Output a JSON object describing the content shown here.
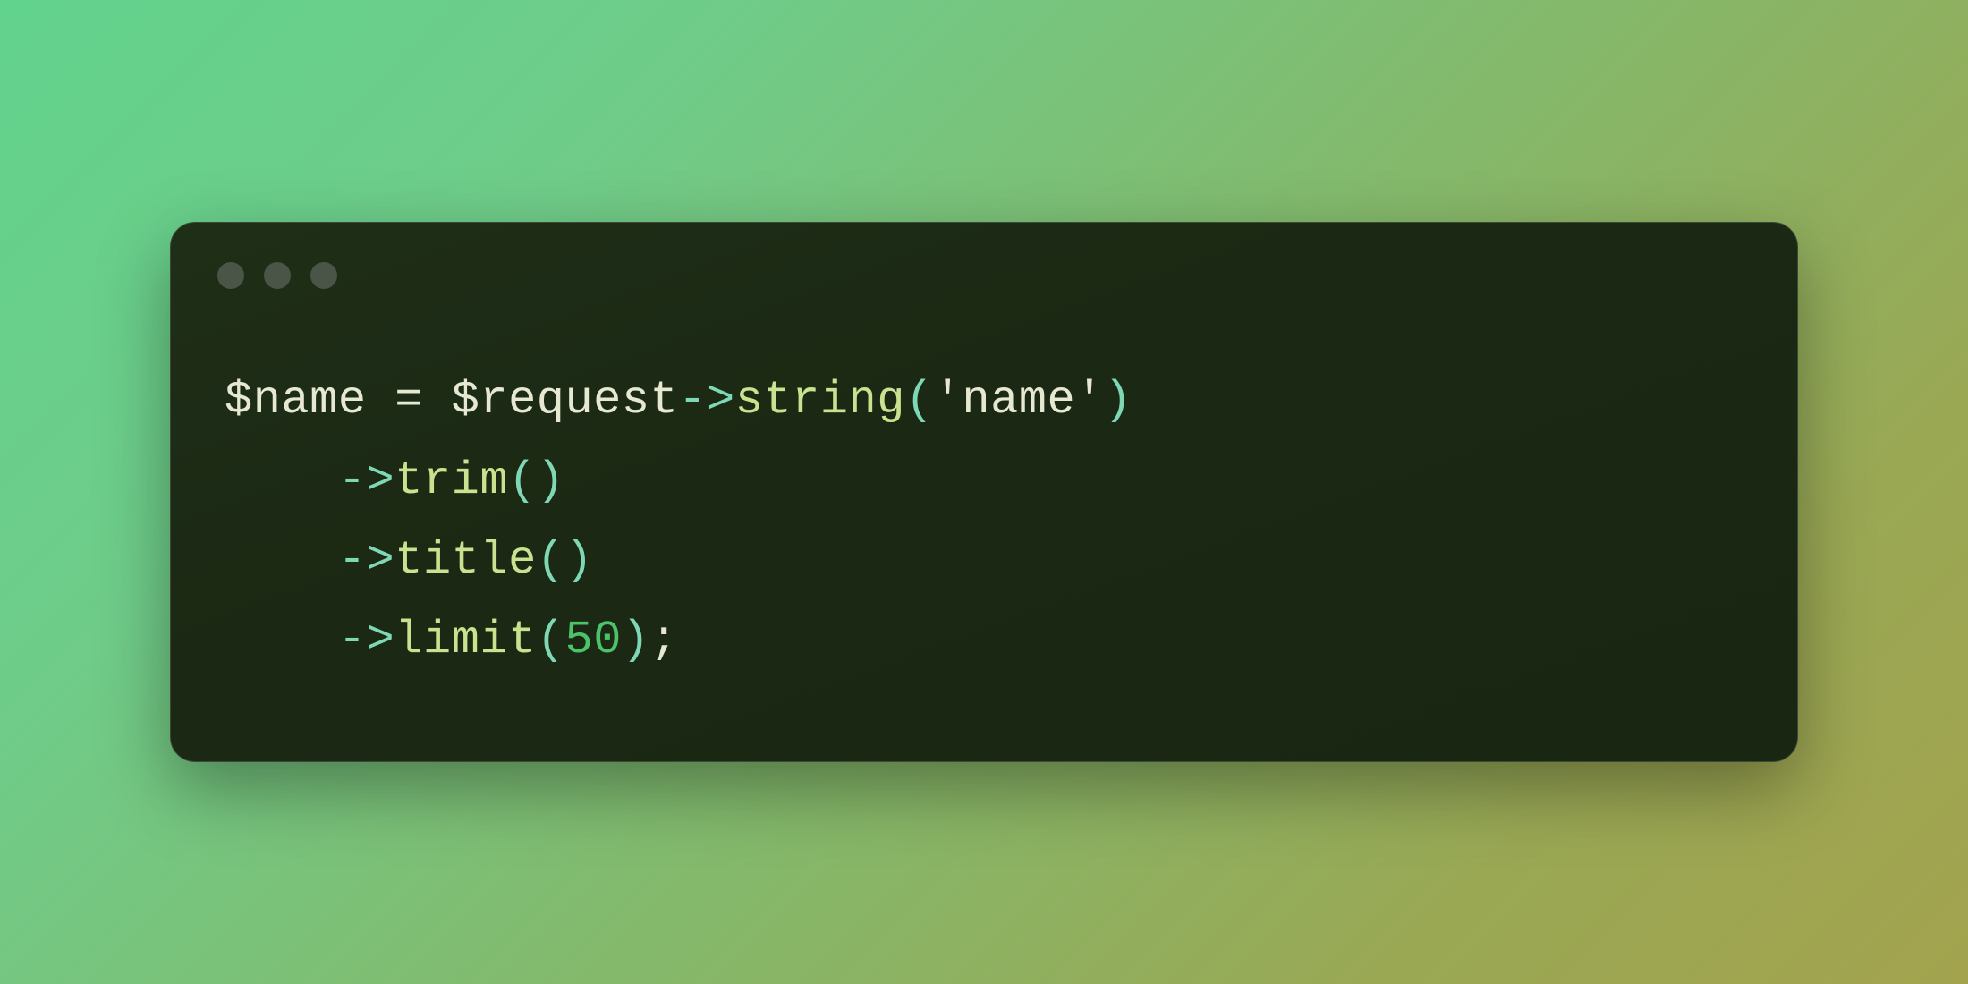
{
  "window": {
    "traffic_dots": 3
  },
  "code": {
    "indent": "    ",
    "line1": {
      "var_name": "$name",
      "assign": " = ",
      "object": "$request",
      "arrow": "->",
      "method": "string",
      "paren_open": "(",
      "arg_quote_open": "'",
      "arg_value": "name",
      "arg_quote_close": "'",
      "paren_close": ")"
    },
    "line2": {
      "arrow": "->",
      "method": "trim",
      "paren_open": "(",
      "paren_close": ")"
    },
    "line3": {
      "arrow": "->",
      "method": "title",
      "paren_open": "(",
      "paren_close": ")"
    },
    "line4": {
      "arrow": "->",
      "method": "limit",
      "paren_open": "(",
      "arg_number": "50",
      "paren_close": ")",
      "semi": ";"
    }
  }
}
